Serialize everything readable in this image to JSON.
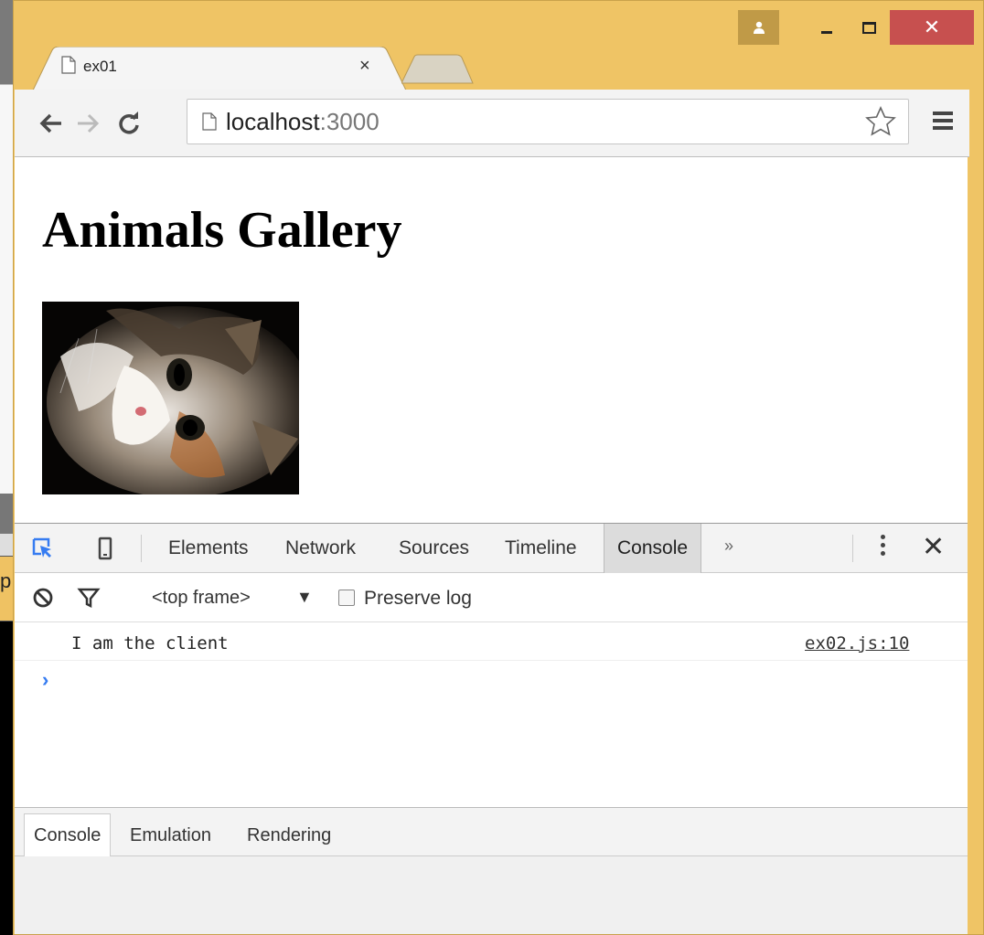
{
  "browser": {
    "tab_title": "ex01",
    "tab_close": "×",
    "url_host": "localhost",
    "url_port": ":3000",
    "close_glyph": "✕"
  },
  "page": {
    "heading": "Animals Gallery",
    "image_alt_icon": "cat-photo"
  },
  "devtools": {
    "tabs": [
      "Elements",
      "Network",
      "Sources",
      "Timeline",
      "Console"
    ],
    "more_glyph": "»",
    "close_glyph": "✕",
    "frame_select": "<top frame>",
    "frame_arrow": "▼",
    "preserve_log_label": "Preserve log",
    "console_message": "I am the client",
    "console_source": "ex02.js:10",
    "prompt_glyph": "›",
    "drawer_tabs": [
      "Console",
      "Emulation",
      "Rendering"
    ]
  },
  "colors": {
    "window_frame": "#efc465",
    "close_button": "#c7504f",
    "prompt": "#367cf1",
    "inspect_icon": "#367cf1"
  }
}
